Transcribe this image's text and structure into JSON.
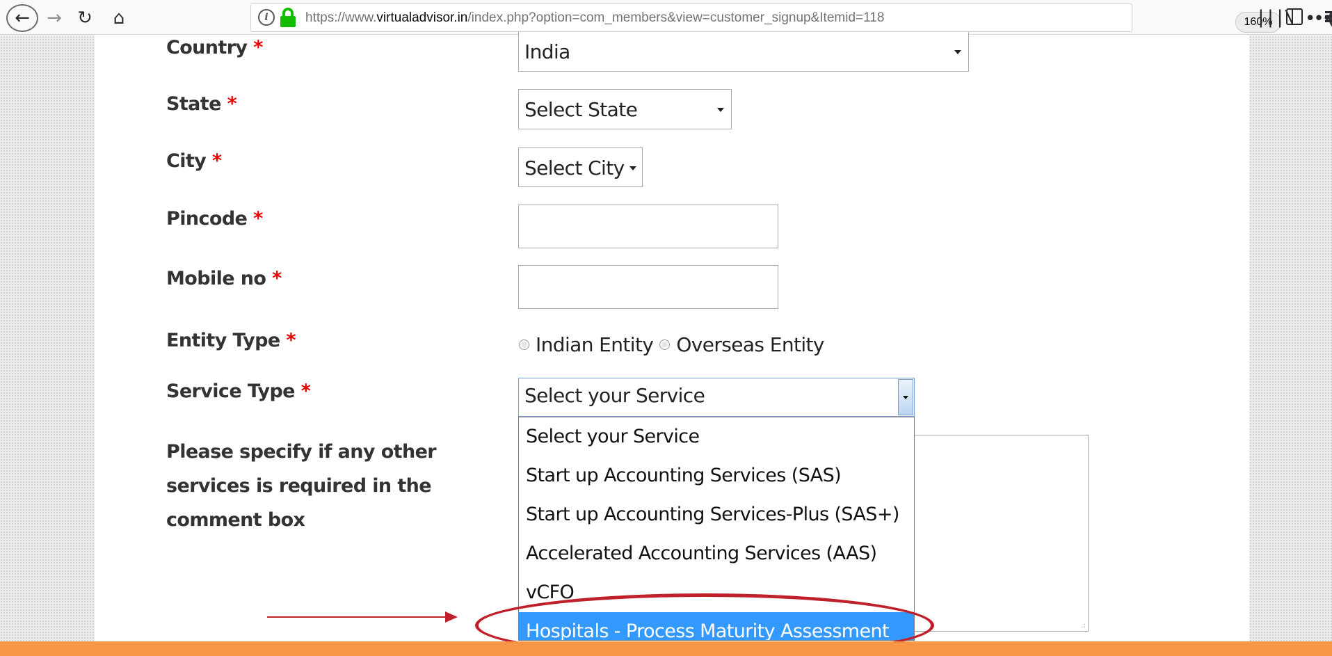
{
  "browser": {
    "url_prefix": "https://www.",
    "url_domain": "virtualadvisor.in",
    "url_path": "/index.php?option=com_members&view=customer_signup&Itemid=118",
    "zoom": "160%",
    "icons": [
      "back-icon",
      "forward-icon",
      "reload-icon",
      "home-icon",
      "info-icon",
      "lock-icon",
      "page-actions-icon",
      "pocket-icon",
      "bookmark-star-icon",
      "library-icon",
      "sidebar-icon",
      "menu-icon"
    ]
  },
  "form": {
    "required_marker": "*",
    "country": {
      "label": "Country",
      "value": "India"
    },
    "state": {
      "label": "State",
      "value": "Select State"
    },
    "city": {
      "label": "City",
      "value": "Select City"
    },
    "pincode": {
      "label": "Pincode",
      "value": ""
    },
    "mobile": {
      "label": "Mobile no",
      "value": ""
    },
    "entity_type": {
      "label": "Entity Type",
      "options": [
        "Indian Entity",
        "Overseas Entity"
      ]
    },
    "service_type": {
      "label": "Service Type",
      "value": "Select your Service",
      "options": [
        "Select your Service",
        "Start up Accounting Services (SAS)",
        "Start up Accounting Services-Plus (SAS+)",
        "Accelerated Accounting Services (AAS)",
        "vCFO",
        "Hospitals - Process Maturity Assessment"
      ],
      "highlighted_option": "Hospitals - Process Maturity Assessment"
    },
    "comment": {
      "label_line1": "Please specify if any other",
      "label_line2": "services is required in the",
      "label_line3": "comment box",
      "value": ""
    }
  },
  "colors": {
    "required": "#e60000",
    "highlight": "#3399ff",
    "annotation": "#c0202a",
    "footer_bar": "#f79646",
    "lock": "#12bc00"
  }
}
